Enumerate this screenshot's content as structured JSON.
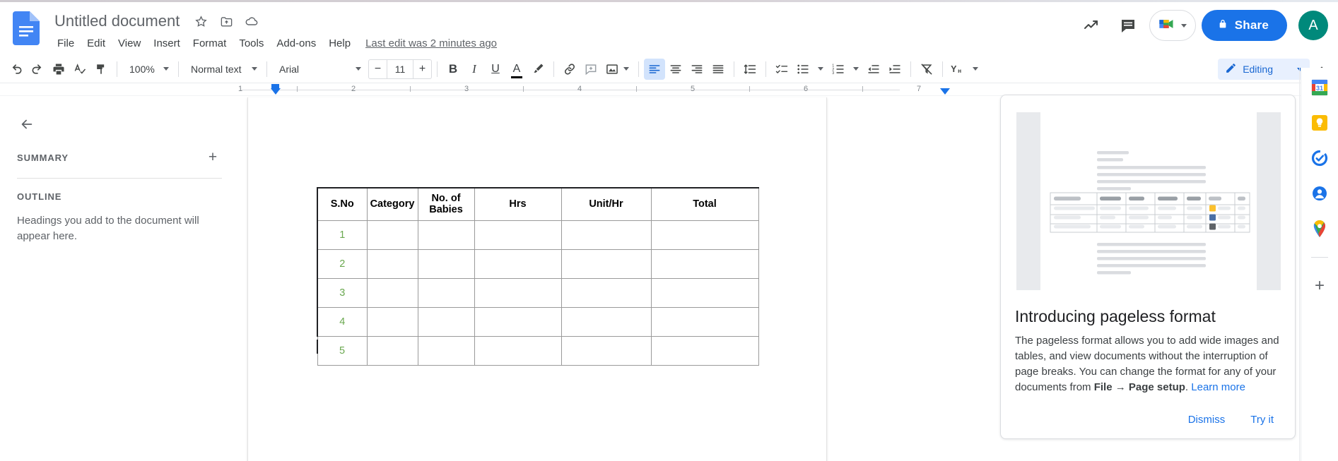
{
  "app": {
    "name": "Google Docs",
    "logo_icon": "docs-logo-icon"
  },
  "header": {
    "doc_title": "Untitled document",
    "title_icons": [
      {
        "name": "star-icon",
        "glyph": "☆"
      },
      {
        "name": "move-to-folder-icon",
        "glyph": "folder"
      },
      {
        "name": "cloud-saved-icon",
        "glyph": "cloud"
      }
    ],
    "menus": [
      "File",
      "Edit",
      "View",
      "Insert",
      "Format",
      "Tools",
      "Add-ons",
      "Help"
    ],
    "last_edit": "Last edit was 2 minutes ago",
    "activity_icon": "activity-dashboard-icon",
    "comments_icon": "comment-history-icon",
    "meet_icon": "google-meet-icon",
    "share_label": "Share",
    "share_lock_icon": "lock-icon",
    "avatar_initial": "A"
  },
  "toolbar": {
    "undo_icon": "undo-icon",
    "redo_icon": "redo-icon",
    "print_icon": "print-icon",
    "spellcheck_icon": "spellcheck-icon",
    "paint_format_icon": "paint-format-icon",
    "zoom_value": "100%",
    "paragraph_style": "Normal text",
    "font_family": "Arial",
    "font_size": "11",
    "decrease_font_label": "−",
    "increase_font_label": "+",
    "bold_label": "B",
    "italic_label": "I",
    "underline_label": "U",
    "text_color_label": "A",
    "highlight_icon": "highlight-pen-icon",
    "link_icon": "insert-link-icon",
    "comment_icon": "add-comment-icon",
    "image_icon": "insert-image-icon",
    "align_left_icon": "align-left-icon",
    "align_center_icon": "align-center-icon",
    "align_right_icon": "align-right-icon",
    "align_justify_icon": "align-justify-icon",
    "line_spacing_icon": "line-spacing-icon",
    "checklist_icon": "checklist-icon",
    "bulleted_list_icon": "bulleted-list-icon",
    "numbered_list_icon": "numbered-list-icon",
    "decrease_indent_icon": "decrease-indent-icon",
    "increase_indent_icon": "increase-indent-icon",
    "clear_formatting_icon": "clear-formatting-icon",
    "input_tools_icon": "input-tools-icon",
    "editing_mode": "Editing",
    "editing_pencil_icon": "pencil-icon",
    "collapse_icon": "hide-menus-chevron-up-icon"
  },
  "ruler": {
    "numbers": [
      "1",
      "2",
      "3",
      "4",
      "5",
      "6",
      "7"
    ],
    "left_indent_marker": "left-indent-marker",
    "right_indent_marker": "right-indent-marker"
  },
  "outline_pane": {
    "back_icon": "back-arrow-icon",
    "summary_label": "SUMMARY",
    "add_summary_icon": "add-summary-plus-icon",
    "outline_label": "OUTLINE",
    "outline_hint": "Headings you add to the document will appear here."
  },
  "document": {
    "table": {
      "headers": [
        "S.No",
        "Category",
        "No. of Babies",
        "Hrs",
        "Unit/Hr",
        "Total"
      ],
      "row_numbers": [
        "1",
        "2",
        "3",
        "4",
        "5"
      ],
      "row_number_color": "#6aa84f",
      "empty_cell": ""
    }
  },
  "promo_card": {
    "title": "Introducing pageless format",
    "body_part1": "The pageless format allows you to add wide images and tables, and view documents without the interruption of page breaks. You can change the format for any of your documents from ",
    "body_bold": "File → Page setup",
    "body_part2": ". ",
    "learn_more": "Learn more",
    "dismiss_label": "Dismiss",
    "try_it_label": "Try it",
    "illustration_name": "pageless-format-illustration"
  },
  "right_rail": {
    "items": [
      {
        "name": "google-calendar-icon",
        "label": "Calendar"
      },
      {
        "name": "google-keep-icon",
        "label": "Keep"
      },
      {
        "name": "google-tasks-icon",
        "label": "Tasks"
      },
      {
        "name": "google-contacts-icon",
        "label": "Contacts"
      },
      {
        "name": "google-maps-icon",
        "label": "Maps"
      }
    ],
    "add_on_label": "+"
  },
  "colors": {
    "brand_blue": "#1a73e8",
    "docs_blue": "#4285f4",
    "accent_light_blue": "#e8f0fe",
    "avatar_teal": "#00897b",
    "row_number_green": "#6aa84f",
    "border_grey": "#dadce0"
  }
}
